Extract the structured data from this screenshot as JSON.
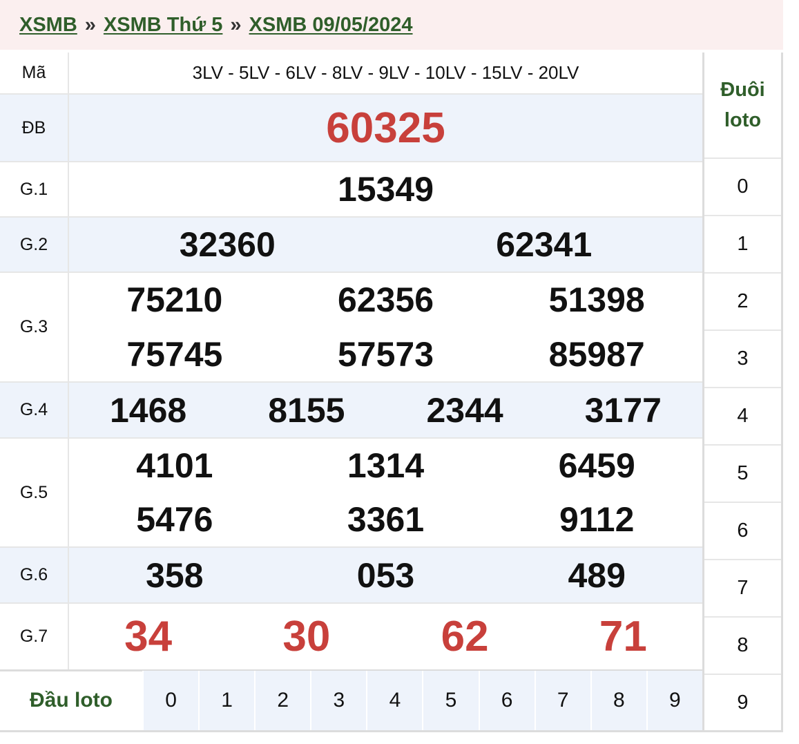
{
  "breadcrumb": {
    "item1": "XSMB",
    "item2": "XSMB Thứ 5",
    "item3": "XSMB 09/05/2024",
    "separator": "»"
  },
  "ma": {
    "label": "Mã",
    "codes": "3LV - 5LV - 6LV - 8LV - 9LV - 10LV - 15LV - 20LV"
  },
  "prizes": {
    "db": {
      "label": "ĐB",
      "numbers": [
        "60325"
      ]
    },
    "g1": {
      "label": "G.1",
      "numbers": [
        "15349"
      ]
    },
    "g2": {
      "label": "G.2",
      "numbers": [
        "32360",
        "62341"
      ]
    },
    "g3": {
      "label": "G.3",
      "numbers": [
        "75210",
        "62356",
        "51398",
        "75745",
        "57573",
        "85987"
      ]
    },
    "g4": {
      "label": "G.4",
      "numbers": [
        "1468",
        "8155",
        "2344",
        "3177"
      ]
    },
    "g5": {
      "label": "G.5",
      "numbers": [
        "4101",
        "1314",
        "6459",
        "5476",
        "3361",
        "9112"
      ]
    },
    "g6": {
      "label": "G.6",
      "numbers": [
        "358",
        "053",
        "489"
      ]
    },
    "g7": {
      "label": "G.7",
      "numbers": [
        "34",
        "30",
        "62",
        "71"
      ]
    }
  },
  "dau_loto": {
    "label": "Đầu loto",
    "digits": [
      "0",
      "1",
      "2",
      "3",
      "4",
      "5",
      "6",
      "7",
      "8",
      "9"
    ]
  },
  "duoi_loto": {
    "label_line1": "Đuôi",
    "label_line2": "loto",
    "digits": [
      "0",
      "1",
      "2",
      "3",
      "4",
      "5",
      "6",
      "7",
      "8",
      "9"
    ]
  },
  "colors": {
    "accent_green": "#2f5e2a",
    "special_red": "#c8403b",
    "row_alt": "#eef3fb",
    "header_bg": "#fbefef"
  }
}
